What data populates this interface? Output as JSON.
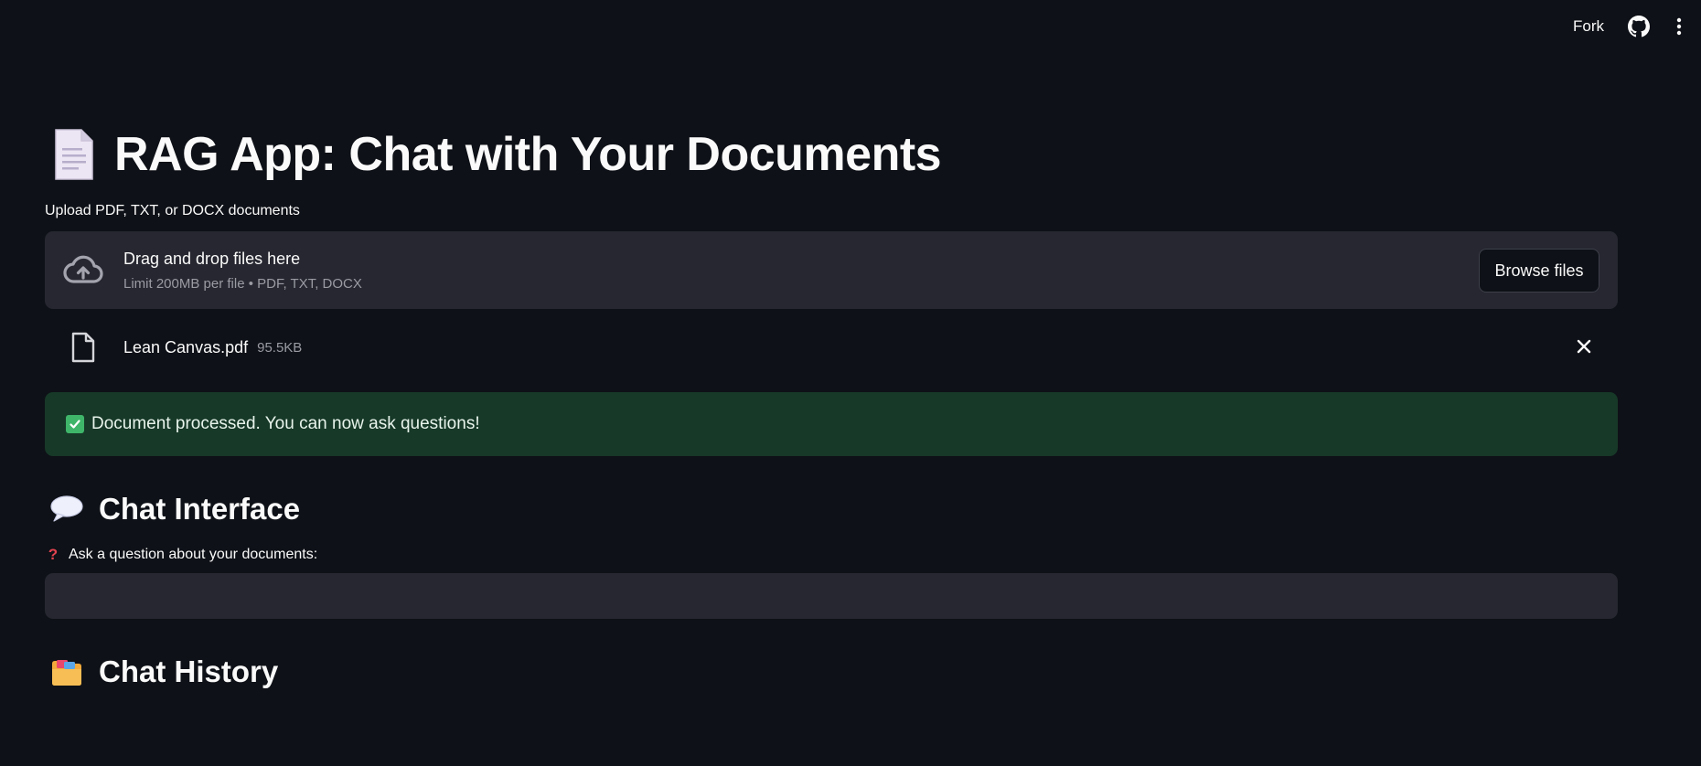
{
  "header": {
    "fork_label": "Fork",
    "github_icon": "github-icon",
    "menu_icon": "kebab-menu-icon"
  },
  "page": {
    "title_icon": "page-facing-up-emoji",
    "title": "RAG App: Chat with Your Documents"
  },
  "uploader": {
    "label": "Upload PDF, TXT, or DOCX documents",
    "dropzone_title": "Drag and drop files here",
    "dropzone_limit": "Limit 200MB per file • PDF, TXT, DOCX",
    "browse_label": "Browse files",
    "files": [
      {
        "name": "Lean Canvas.pdf",
        "size": "95.5KB"
      }
    ]
  },
  "status": {
    "success_message": "Document processed. You can now ask questions!",
    "success_color": "#173928"
  },
  "chat": {
    "heading": "Chat Interface",
    "question_label": "Ask a question about your documents:",
    "question_value": "",
    "question_placeholder": ""
  },
  "history": {
    "heading": "Chat History"
  },
  "colors": {
    "background": "#0e1117",
    "surface": "#262730",
    "text": "#fafafa",
    "muted": "#9a9ba3",
    "success_bg": "#173928",
    "accent_red": "#e2424f"
  }
}
